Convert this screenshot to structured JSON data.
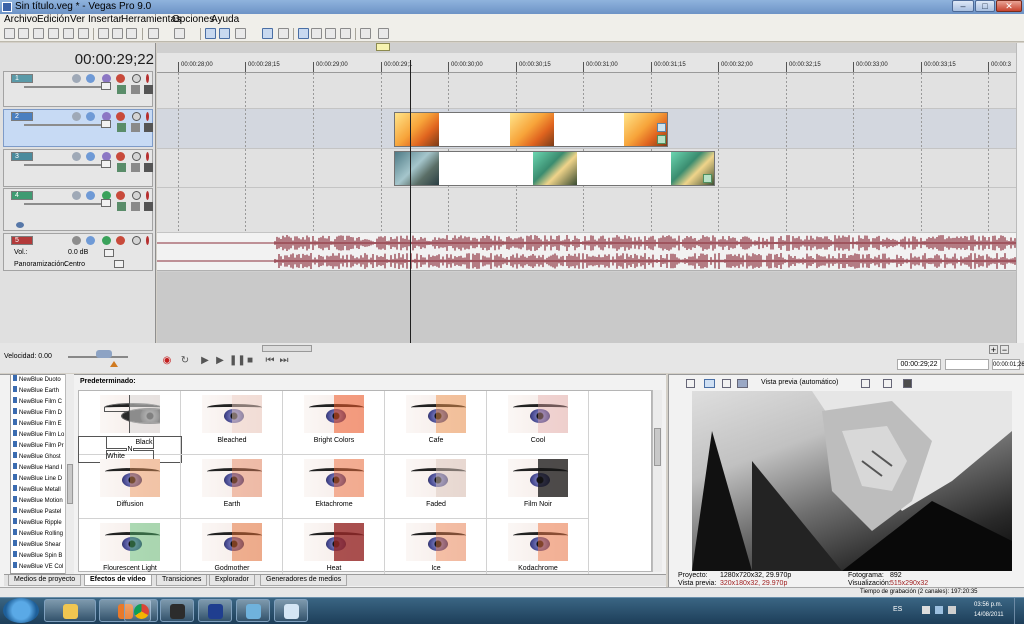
{
  "window": {
    "title": "Sin título.veg * - Vegas Pro 9.0",
    "minimize": "–",
    "maximize": "□",
    "close": "✕"
  },
  "menu": [
    "Archivo",
    "Edición",
    "Ver",
    "Insertar",
    "Herramientas",
    "Opciones",
    "Ayuda"
  ],
  "timecode": "00:00:29;22",
  "tracks": [
    {
      "num": "1",
      "color": "#5a9aa8"
    },
    {
      "num": "2",
      "color": "#4a7fc0"
    },
    {
      "num": "3",
      "color": "#4b8b9d"
    },
    {
      "num": "4",
      "color": "#3f9b72"
    }
  ],
  "audio_track": {
    "num": "5",
    "color": "#b33a3a",
    "vol_label": "Vol.:",
    "vol_value": "0.0 dB",
    "pan_label": "Panoramización:",
    "pan_value": "Centro"
  },
  "ruler": [
    "00:00:28;00",
    "00:00:28;15",
    "00:00:29;00",
    "00:00:29;1",
    "00:00:30;00",
    "00:00:30;15",
    "00:00:31;00",
    "00:00:31;15",
    "00:00:32;00",
    "00:00:32;15",
    "00:00:33;00",
    "00:00:33;15",
    "00:00:3"
  ],
  "speed": {
    "label": "Velocidad: 0.00"
  },
  "transport_times": {
    "current": "00:00:29;22",
    "length": "00:00:01;26"
  },
  "fx_plugins": [
    "NewBlue Duoto",
    "NewBlue Earth",
    "NewBlue Film C",
    "NewBlue Film D",
    "NewBlue Film E",
    "NewBlue Film Lo",
    "NewBlue Film Pr",
    "NewBlue Ghost",
    "NewBlue Hand I",
    "NewBlue Line D",
    "NewBlue Metall",
    "NewBlue Motion",
    "NewBlue Pastel",
    "NewBlue Ripple",
    "NewBlue Rolling",
    "NewBlue Shear",
    "NewBlue Spin B",
    "NewBlue VE Col"
  ],
  "preset_heading": "Predeterminado:",
  "presets": [
    "Black N White",
    "Bleached",
    "Bright Colors",
    "Cafe",
    "Cool",
    "Diffusion",
    "Earth",
    "Ektachrome",
    "Faded",
    "Film Noir",
    "Flourescent Light",
    "Godmother",
    "Heat",
    "Ice",
    "Kodachrome"
  ],
  "tabs": [
    "Medios de proyecto",
    "Efectos de vídeo",
    "Transiciones",
    "Explorador",
    "Generadores de medios"
  ],
  "preview": {
    "mode": "Vista previa (automático)",
    "proyecto_label": "Proyecto:",
    "proyecto_value": "1280x720x32, 29.970p",
    "vista_label": "Vista previa:",
    "vista_value": "320x180x32, 29.970p",
    "fotograma_label": "Fotograma:",
    "fotograma_value": "892",
    "visualizacion_label": "Visualización:",
    "visualizacion_value": "515x290x32"
  },
  "status": {
    "recording": "Tiempo de grabación (2 canales): 197:20:35"
  },
  "taskbar": {
    "lang": "ES",
    "time": "03:56 p.m.",
    "date": "14/08/2011"
  },
  "colors": {
    "accent": "#4a6fa5",
    "audio_wave": "#8b2d3a"
  }
}
